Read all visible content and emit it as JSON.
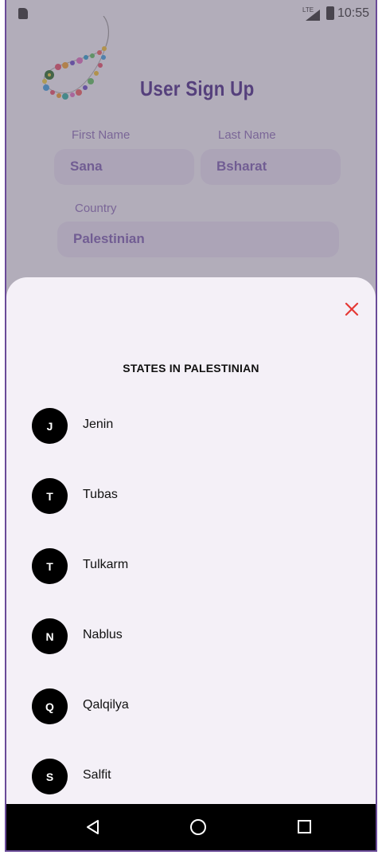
{
  "status_bar": {
    "time": "10:55",
    "network": "LTE"
  },
  "background": {
    "title": "User Sign Up",
    "first_name": {
      "label": "First Name",
      "value": "Sana"
    },
    "last_name": {
      "label": "Last Name",
      "value": "Bsharat"
    },
    "country": {
      "label": "Country",
      "value": "Palestinian"
    }
  },
  "sheet": {
    "title": "STATES IN PALESTINIAN",
    "states": [
      {
        "initial": "J",
        "name": "Jenin"
      },
      {
        "initial": "T",
        "name": "Tubas"
      },
      {
        "initial": "T",
        "name": "Tulkarm"
      },
      {
        "initial": "N",
        "name": "Nablus"
      },
      {
        "initial": "Q",
        "name": "Qalqilya"
      },
      {
        "initial": "S",
        "name": "Salfit"
      }
    ]
  },
  "colors": {
    "accent": "#4a2a88",
    "close": "#e53935",
    "avatar": "#000000"
  }
}
